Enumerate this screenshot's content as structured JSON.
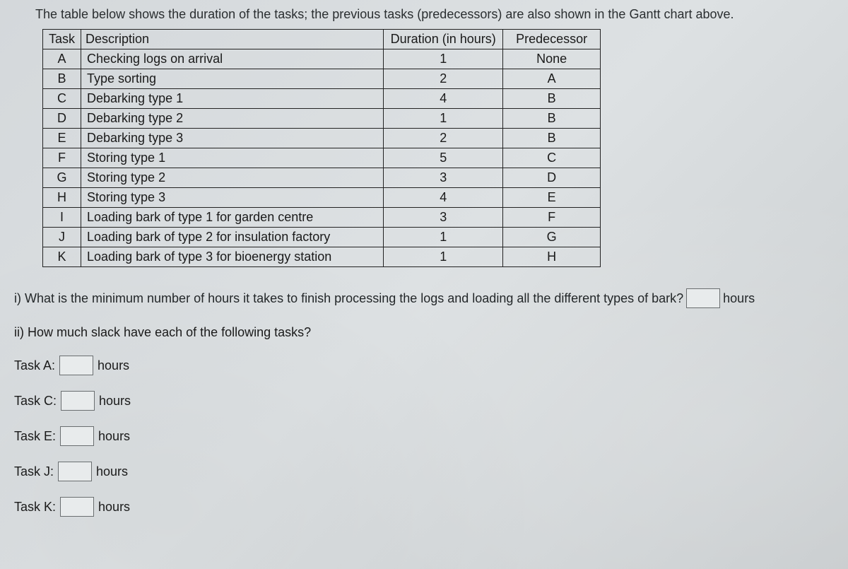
{
  "intro_text": "The table below shows the duration of the tasks; the previous tasks (predecessors) are also shown in the Gantt chart above.",
  "table": {
    "headers": {
      "task": "Task",
      "description": "Description",
      "duration": "Duration (in hours)",
      "predecessor": "Predecessor"
    },
    "rows": [
      {
        "task": "A",
        "description": "Checking logs on arrival",
        "duration": "1",
        "predecessor": "None"
      },
      {
        "task": "B",
        "description": "Type sorting",
        "duration": "2",
        "predecessor": "A"
      },
      {
        "task": "C",
        "description": "Debarking type 1",
        "duration": "4",
        "predecessor": "B"
      },
      {
        "task": "D",
        "description": "Debarking type 2",
        "duration": "1",
        "predecessor": "B"
      },
      {
        "task": "E",
        "description": "Debarking type 3",
        "duration": "2",
        "predecessor": "B"
      },
      {
        "task": "F",
        "description": "Storing type 1",
        "duration": "5",
        "predecessor": "C"
      },
      {
        "task": "G",
        "description": "Storing type 2",
        "duration": "3",
        "predecessor": "D"
      },
      {
        "task": "H",
        "description": "Storing type 3",
        "duration": "4",
        "predecessor": "E"
      },
      {
        "task": "I",
        "description": "Loading bark of type 1 for garden centre",
        "duration": "3",
        "predecessor": "F"
      },
      {
        "task": "J",
        "description": "Loading bark of type 2 for insulation factory",
        "duration": "1",
        "predecessor": "G"
      },
      {
        "task": "K",
        "description": "Loading bark of type 3 for bioenergy station",
        "duration": "1",
        "predecessor": "H"
      }
    ]
  },
  "questions": {
    "q1_text": "i) What is the minimum number of hours it takes to finish processing the logs and loading all the different types of bark?",
    "q1_unit": "hours",
    "q2_text": "ii) How much slack have each of the following tasks?",
    "slack_tasks": [
      {
        "label": "Task A:",
        "unit": "hours"
      },
      {
        "label": "Task C:",
        "unit": "hours"
      },
      {
        "label": "Task E:",
        "unit": "hours"
      },
      {
        "label": "Task J:",
        "unit": "hours"
      },
      {
        "label": "Task K:",
        "unit": "hours"
      }
    ]
  }
}
